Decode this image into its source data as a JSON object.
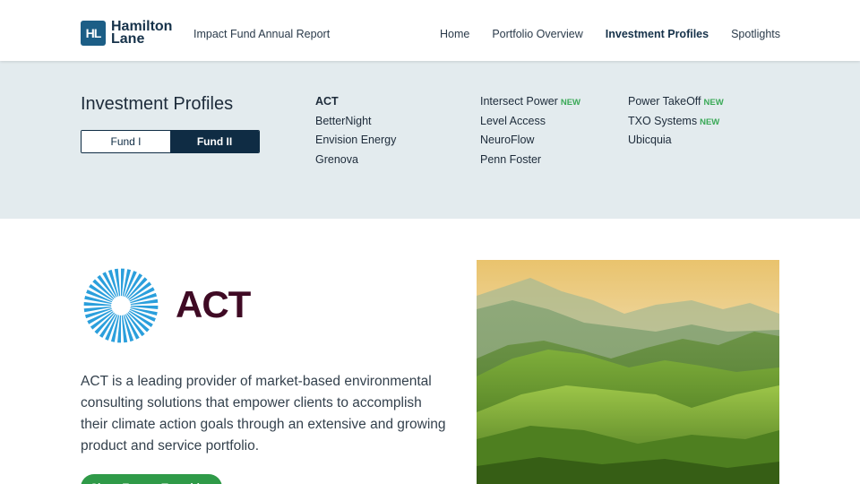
{
  "header": {
    "logo_mark": "HL",
    "logo_line1": "Hamilton",
    "logo_line2": "Lane",
    "report_title": "Impact Fund Annual Report",
    "nav": [
      {
        "label": "Home"
      },
      {
        "label": "Portfolio Overview"
      },
      {
        "label": "Investment Profiles",
        "active": true
      },
      {
        "label": "Spotlights"
      }
    ]
  },
  "profiles": {
    "title": "Investment Profiles",
    "fund_tabs": [
      {
        "label": "Fund I",
        "selected": false
      },
      {
        "label": "Fund II",
        "selected": true
      }
    ],
    "new_badge": "NEW",
    "companies": [
      [
        {
          "name": "ACT",
          "current": true
        },
        {
          "name": "BetterNight"
        },
        {
          "name": "Envision Energy"
        },
        {
          "name": "Grenova"
        }
      ],
      [
        {
          "name": "Intersect Power",
          "new": true
        },
        {
          "name": "Level Access"
        },
        {
          "name": "NeuroFlow"
        },
        {
          "name": "Penn Foster"
        }
      ],
      [
        {
          "name": "Power TakeOff",
          "new": true
        },
        {
          "name": "TXO Systems",
          "new": true
        },
        {
          "name": "Ubicquia"
        }
      ]
    ]
  },
  "company": {
    "name": "ACT",
    "description": "ACT is a leading provider of market-based environmental consulting solutions that empower clients to accomplish their climate action goals through an extensive and growing product and service portfolio.",
    "tag_button": "Clean Energy Transition"
  },
  "colors": {
    "brand_navy": "#0f2c44",
    "band_bg": "#e3ebee",
    "new_green": "#3aa957",
    "act_maroon": "#3f0a24",
    "act_blue": "#2b9fdc"
  },
  "icons": {
    "logo": "hamilton-lane-logo",
    "company_logo": "act-sunburst-icon",
    "hero_image": "green-mountains-image"
  }
}
